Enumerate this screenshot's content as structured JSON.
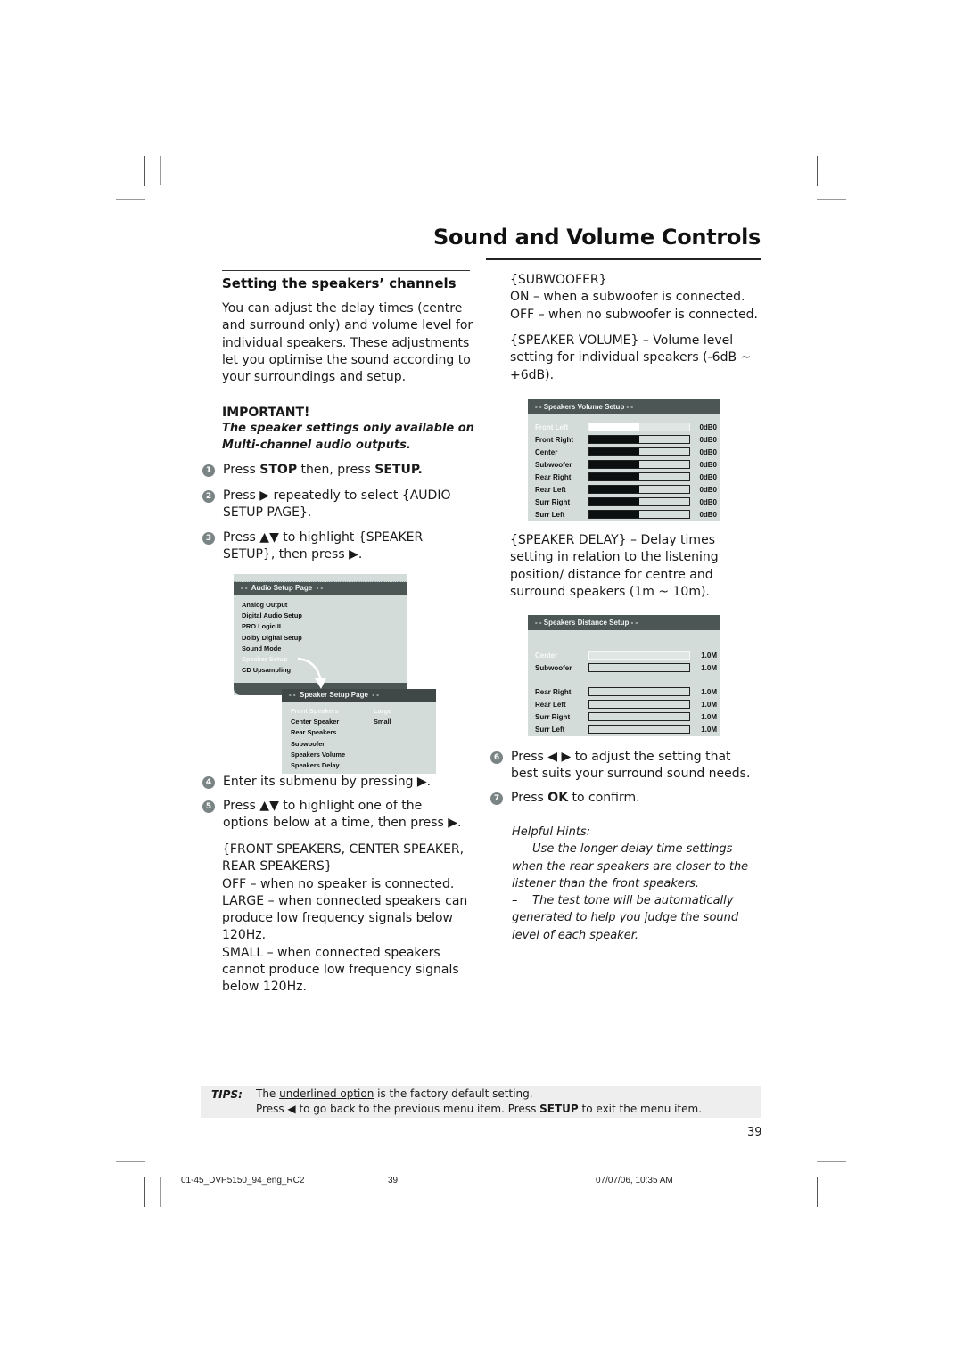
{
  "header": {
    "title": "Sound and Volume Controls"
  },
  "section": {
    "title": "Setting the speakers’ channels",
    "intro": "You can adjust the delay times (centre and surround only) and volume level for individual speakers. These adjustments let you optimise the sound according to your surroundings and setup.",
    "important_heading": "IMPORTANT!",
    "important_text": "The speaker settings only available on Multi-channel audio outputs."
  },
  "steps": [
    {
      "num": "1",
      "parts": [
        "Press ",
        "STOP",
        " then, press ",
        "SETUP."
      ]
    },
    {
      "num": "2",
      "text": "Press ▶ repeatedly to select {AUDIO SETUP PAGE}."
    },
    {
      "num": "3",
      "text": "Press ▲▼ to highlight {SPEAKER SETUP}, then press ▶."
    },
    {
      "num": "4",
      "text": "Enter its submenu by pressing ▶."
    },
    {
      "num": "5",
      "text": "Press ▲▼  to highlight one of the options below at a time, then press ▶."
    },
    {
      "num": "6",
      "text": "Press ◀ ▶ to adjust the setting that best suits your surround sound needs."
    },
    {
      "num": "7",
      "parts": [
        "Press ",
        "OK",
        " to confirm."
      ]
    }
  ],
  "options_text": {
    "front_heading": "{FRONT SPEAKERS, CENTER SPEAKER, REAR SPEAKERS}",
    "off": "OFF – when no speaker is connected.",
    "large": "LARGE – when connected speakers can produce low frequency signals below 120Hz.",
    "small": "SMALL – when connected speakers cannot produce low frequency signals below 120Hz.",
    "subwoofer_heading": "{SUBWOOFER}",
    "sub_on": "ON – when a subwoofer is connected.",
    "sub_off": "OFF – when no subwoofer is connected.",
    "speaker_volume": "{SPEAKER VOLUME} – Volume level setting for individual speakers (-6dB ~ +6dB).",
    "speaker_delay": "{SPEAKER DELAY} – Delay times setting in relation to the listening position/ distance for centre and surround speakers (1m ~ 10m)."
  },
  "audio_setup_menu": {
    "title": "- -  Audio Setup Page  - -",
    "items": [
      {
        "label": "Analog Output",
        "highlighted": false
      },
      {
        "label": "Digital Audio Setup",
        "highlighted": false
      },
      {
        "label": "PRO Logic II",
        "highlighted": false
      },
      {
        "label": "Dolby Digital Setup",
        "highlighted": false
      },
      {
        "label": "Sound Mode",
        "highlighted": false
      },
      {
        "label": "Speaker Setup",
        "highlighted": true
      },
      {
        "label": "CD Upsampling",
        "highlighted": false
      }
    ]
  },
  "speaker_setup_menu": {
    "title": "- -  Speaker Setup Page  - -",
    "items": [
      {
        "label": "Front Speakers",
        "value": "Large",
        "highlighted": true
      },
      {
        "label": "Center Speaker",
        "value": "Small",
        "highlighted": false
      },
      {
        "label": "Rear Speakers",
        "value": "",
        "highlighted": false
      },
      {
        "label": "Subwoofer",
        "value": "",
        "highlighted": false
      },
      {
        "label": "Speakers Volume",
        "value": "",
        "highlighted": false
      },
      {
        "label": "Speakers Delay",
        "value": "",
        "highlighted": false
      }
    ]
  },
  "volume_menu": {
    "title": "- - Speakers Volume Setup - -",
    "rows": [
      {
        "label": "Front Left",
        "value": "0dB0",
        "level": 0.5,
        "highlighted": true
      },
      {
        "label": "Front Right",
        "value": "0dB0",
        "level": 0.5,
        "highlighted": false
      },
      {
        "label": "Center",
        "value": "0dB0",
        "level": 0.5,
        "highlighted": false
      },
      {
        "label": "Subwoofer",
        "value": "0dB0",
        "level": 0.5,
        "highlighted": false
      },
      {
        "label": "Rear Right",
        "value": "0dB0",
        "level": 0.5,
        "highlighted": false
      },
      {
        "label": "Rear Left",
        "value": "0dB0",
        "level": 0.5,
        "highlighted": false
      },
      {
        "label": "Surr Right",
        "value": "0dB0",
        "level": 0.5,
        "highlighted": false
      },
      {
        "label": "Surr Left",
        "value": "0dB0",
        "level": 0.5,
        "highlighted": false
      }
    ]
  },
  "distance_menu": {
    "title": "- - Speakers Distance Setup - -",
    "rows": [
      {
        "label": "Center",
        "value": "1.0M",
        "level": 0,
        "highlighted": true
      },
      {
        "label": "Subwoofer",
        "value": "1.0M",
        "level": 0,
        "highlighted": false
      },
      {
        "label": "Rear Right",
        "value": "1.0M",
        "level": 0,
        "highlighted": false
      },
      {
        "label": "Rear Left",
        "value": "1.0M",
        "level": 0,
        "highlighted": false
      },
      {
        "label": "Surr Right",
        "value": "1.0M",
        "level": 0,
        "highlighted": false
      },
      {
        "label": "Surr Left",
        "value": "1.0M",
        "level": 0,
        "highlighted": false
      }
    ]
  },
  "hints": {
    "title": "Helpful Hints:",
    "items": [
      "–    Use the longer delay time settings when the rear speakers are closer to the listener than the front speakers.",
      "–    The test tone will be automatically generated to help you judge the sound level of each speaker."
    ]
  },
  "tips": {
    "label": "TIPS:",
    "line1_pre": "The ",
    "line1_ul": "underlined option",
    "line1_post": " is the factory default setting.",
    "line2_pre": "Press ◀ to go back to the previous menu item. Press ",
    "line2_bold": "SETUP",
    "line2_post": " to exit the menu item."
  },
  "page_number": "39",
  "footer": {
    "file": "01-45_DVP5150_94_eng_RC2",
    "page": "39",
    "timestamp": "07/07/06, 10:35 AM"
  }
}
